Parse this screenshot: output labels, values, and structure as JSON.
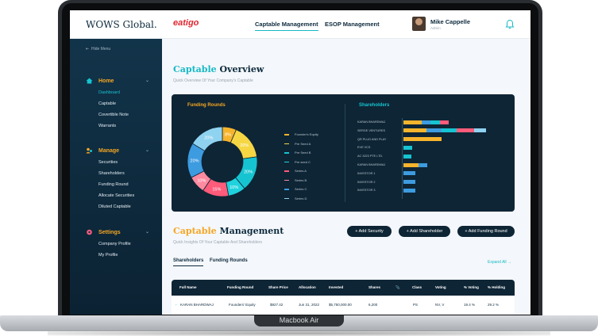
{
  "device": {
    "label": "Macbook Air"
  },
  "header": {
    "brand": "WOWS Global.",
    "partner_logo": "eatigo",
    "nav": [
      "Captable Management",
      "ESOP Management"
    ],
    "user": {
      "name": "Mike Cappelle",
      "role": "Admin"
    },
    "bell_icon": "bell-icon"
  },
  "sidebar": {
    "hide_label": "Hide Menu",
    "sections": [
      {
        "label": "Home",
        "icon": "home-icon",
        "items": [
          "Dashboard",
          "Captable",
          "Covertible Note",
          "Warrants"
        ]
      },
      {
        "label": "Manage",
        "icon": "users-icon",
        "items": [
          "Securities",
          "Shareholders",
          "Funding Round",
          "Allocate Securities",
          "Diluted Captable"
        ]
      },
      {
        "label": "Settings",
        "icon": "gear-icon",
        "items": [
          "Company Profile",
          "My Profile"
        ]
      }
    ],
    "active_item": "Dashboard"
  },
  "overview": {
    "title_accent": "Captable",
    "title_rest": " Overview",
    "subtitle": "Quick Overview Of Your Company's Captable",
    "funding_title": "Funding Rounds",
    "shareholders_title": "Shareholders"
  },
  "colors": {
    "accent_cyan": "#16b9c6",
    "accent_orange": "#f6a623",
    "navy": "#0e2535"
  },
  "chart_data": [
    {
      "type": "pie",
      "title": "Funding Rounds",
      "categories": [
        "Founder's Equity",
        "Pre Seed A",
        "Pre Seed B",
        "Pre seed C",
        "Series A",
        "Series B",
        "Series C",
        "Series D"
      ],
      "values": [
        8,
        20,
        20,
        10,
        15,
        10,
        20,
        20
      ],
      "labels": [
        "8%",
        "20%",
        "20%",
        "10%",
        "15%",
        "10%",
        "20%",
        "20%"
      ],
      "colors": [
        "#f6b42c",
        "#f6d743",
        "#16c4d1",
        "#1fd3de",
        "#ff5b7a",
        "#ff8aa0",
        "#3d9be0",
        "#8fd3f0"
      ],
      "legend": "right"
    },
    {
      "type": "bar",
      "title": "Shareholders",
      "orientation": "horizontal",
      "stacked": true,
      "categories": [
        "KARAN BHARDWAJ",
        "SERGE VENTURES",
        "QR PLUG AND PLAY",
        "EVE VCS",
        "AC 3223 PTE LTD.",
        "KARAN BHARDWAJ",
        "INVESTOR 1",
        "INVESTOR 2",
        "INVESTOR 3"
      ],
      "series": [
        {
          "values": [
            12,
            15,
            25,
            0,
            0,
            10,
            0,
            0,
            0
          ],
          "color": "#f6b42c"
        },
        {
          "values": [
            6,
            10,
            0,
            0,
            0,
            6,
            8,
            8,
            8
          ],
          "color": "#3d9be0"
        },
        {
          "values": [
            6,
            10,
            0,
            6,
            5,
            0,
            0,
            0,
            0
          ],
          "color": "#16c4d1"
        },
        {
          "values": [
            6,
            12,
            0,
            0,
            0,
            0,
            0,
            0,
            0
          ],
          "color": "#ff5b7a"
        },
        {
          "values": [
            0,
            8,
            0,
            0,
            0,
            0,
            0,
            0,
            0
          ],
          "color": "#8fd3f0"
        }
      ]
    }
  ],
  "management": {
    "title_accent": "Captable",
    "title_rest": " Management",
    "subtitle": "Quick Insights Of Your Captable And Shareholders",
    "buttons": [
      "+ Add Security",
      "+ Add Shareholder",
      "+ Add Funding Round"
    ],
    "tabs": [
      "Shareholders",
      "Funding Rounds"
    ],
    "expand_label": "Expand All →",
    "columns": [
      "Full Name",
      "Funding Round",
      "Share Price",
      "Allocation",
      "Invested",
      "Shares",
      "Class",
      "Voting",
      "% Voting",
      "% Holding"
    ],
    "rows": [
      [
        "KARAN BHARDWAJ",
        "Founders' Equity",
        "$927.42",
        "Jun 31, 2022",
        "$5,750,000.00",
        "6,200",
        "PS",
        "NV, V",
        "19.4 %",
        "29.2 %"
      ]
    ]
  }
}
